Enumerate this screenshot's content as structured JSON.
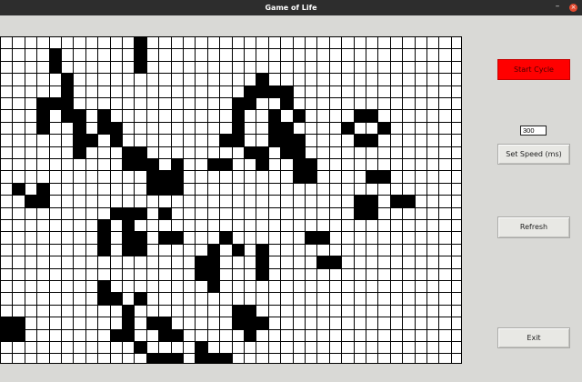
{
  "window": {
    "title": "Game of Life",
    "minimize_glyph": "–",
    "close_glyph": "×",
    "close_color": "#e2492f"
  },
  "board": {
    "rows": 27,
    "cols": 38,
    "live_color": "#000000",
    "dead_color": "#ffffff",
    "grid_color": "#000000",
    "live_cells": [
      [
        0,
        11
      ],
      [
        1,
        4
      ],
      [
        1,
        11
      ],
      [
        2,
        4
      ],
      [
        2,
        11
      ],
      [
        3,
        5
      ],
      [
        3,
        21
      ],
      [
        4,
        5
      ],
      [
        4,
        20
      ],
      [
        4,
        21
      ],
      [
        4,
        22
      ],
      [
        4,
        23
      ],
      [
        5,
        3
      ],
      [
        5,
        4
      ],
      [
        5,
        5
      ],
      [
        5,
        19
      ],
      [
        5,
        20
      ],
      [
        5,
        23
      ],
      [
        6,
        3
      ],
      [
        6,
        5
      ],
      [
        6,
        6
      ],
      [
        6,
        8
      ],
      [
        6,
        19
      ],
      [
        6,
        22
      ],
      [
        6,
        24
      ],
      [
        6,
        29
      ],
      [
        6,
        30
      ],
      [
        7,
        3
      ],
      [
        7,
        6
      ],
      [
        7,
        8
      ],
      [
        7,
        9
      ],
      [
        7,
        19
      ],
      [
        7,
        22
      ],
      [
        7,
        23
      ],
      [
        7,
        28
      ],
      [
        7,
        31
      ],
      [
        8,
        6
      ],
      [
        8,
        7
      ],
      [
        8,
        9
      ],
      [
        8,
        18
      ],
      [
        8,
        19
      ],
      [
        8,
        22
      ],
      [
        8,
        23
      ],
      [
        8,
        24
      ],
      [
        8,
        29
      ],
      [
        8,
        30
      ],
      [
        9,
        6
      ],
      [
        9,
        10
      ],
      [
        9,
        11
      ],
      [
        9,
        20
      ],
      [
        9,
        21
      ],
      [
        9,
        23
      ],
      [
        9,
        24
      ],
      [
        10,
        10
      ],
      [
        10,
        11
      ],
      [
        10,
        12
      ],
      [
        10,
        14
      ],
      [
        10,
        17
      ],
      [
        10,
        18
      ],
      [
        10,
        21
      ],
      [
        10,
        24
      ],
      [
        10,
        25
      ],
      [
        11,
        12
      ],
      [
        11,
        13
      ],
      [
        11,
        14
      ],
      [
        11,
        24
      ],
      [
        11,
        25
      ],
      [
        11,
        30
      ],
      [
        11,
        31
      ],
      [
        12,
        1
      ],
      [
        12,
        3
      ],
      [
        12,
        12
      ],
      [
        12,
        13
      ],
      [
        12,
        14
      ],
      [
        13,
        2
      ],
      [
        13,
        3
      ],
      [
        13,
        29
      ],
      [
        13,
        30
      ],
      [
        13,
        32
      ],
      [
        13,
        33
      ],
      [
        14,
        9
      ],
      [
        14,
        10
      ],
      [
        14,
        11
      ],
      [
        14,
        13
      ],
      [
        14,
        29
      ],
      [
        14,
        30
      ],
      [
        15,
        8
      ],
      [
        15,
        10
      ],
      [
        16,
        8
      ],
      [
        16,
        10
      ],
      [
        16,
        11
      ],
      [
        16,
        13
      ],
      [
        16,
        14
      ],
      [
        16,
        18
      ],
      [
        16,
        25
      ],
      [
        16,
        26
      ],
      [
        17,
        8
      ],
      [
        17,
        10
      ],
      [
        17,
        11
      ],
      [
        17,
        17
      ],
      [
        17,
        19
      ],
      [
        17,
        21
      ],
      [
        18,
        16
      ],
      [
        18,
        17
      ],
      [
        18,
        21
      ],
      [
        18,
        26
      ],
      [
        18,
        27
      ],
      [
        19,
        16
      ],
      [
        19,
        17
      ],
      [
        19,
        21
      ],
      [
        20,
        8
      ],
      [
        20,
        17
      ],
      [
        21,
        8
      ],
      [
        21,
        9
      ],
      [
        21,
        11
      ],
      [
        22,
        10
      ],
      [
        22,
        19
      ],
      [
        22,
        20
      ],
      [
        23,
        0
      ],
      [
        23,
        1
      ],
      [
        23,
        10
      ],
      [
        23,
        12
      ],
      [
        23,
        13
      ],
      [
        23,
        19
      ],
      [
        23,
        20
      ],
      [
        23,
        21
      ],
      [
        24,
        0
      ],
      [
        24,
        1
      ],
      [
        24,
        9
      ],
      [
        24,
        10
      ],
      [
        24,
        13
      ],
      [
        24,
        14
      ],
      [
        24,
        20
      ],
      [
        25,
        11
      ],
      [
        25,
        16
      ],
      [
        26,
        12
      ],
      [
        26,
        13
      ],
      [
        26,
        14
      ],
      [
        26,
        16
      ],
      [
        26,
        17
      ],
      [
        26,
        18
      ]
    ]
  },
  "controls": {
    "start_cycle_label": "Start Cycle",
    "start_cycle_color": "#ff0000",
    "speed_value": "300",
    "set_speed_label": "Set Speed (ms)",
    "refresh_label": "Refresh",
    "exit_label": "Exit"
  }
}
